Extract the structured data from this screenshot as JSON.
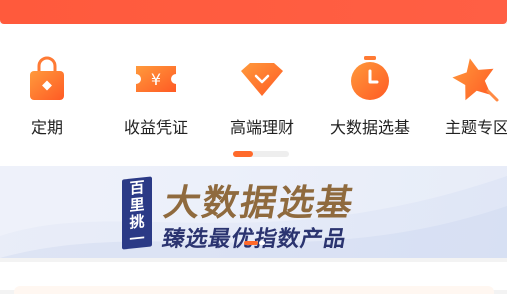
{
  "menu": {
    "items": [
      {
        "label": "定期",
        "icon": "lock-icon"
      },
      {
        "label": "收益凭证",
        "icon": "ticket-icon"
      },
      {
        "label": "高端理财",
        "icon": "diamond-icon"
      },
      {
        "label": "大数据选基",
        "icon": "clock-icon"
      },
      {
        "label": "主题专区",
        "icon": "star-icon"
      }
    ]
  },
  "banner": {
    "badge_chars": [
      "百",
      "里",
      "挑",
      "一"
    ],
    "title": "大数据选基",
    "subtitle": "臻选最优指数产品"
  },
  "colors": {
    "brand": "#ff5a3c",
    "icon_orange": "#ff6a2b",
    "banner_title": "#8f6a3e",
    "banner_subtitle": "#2b3470",
    "badge_bg": "#2b3a86"
  }
}
